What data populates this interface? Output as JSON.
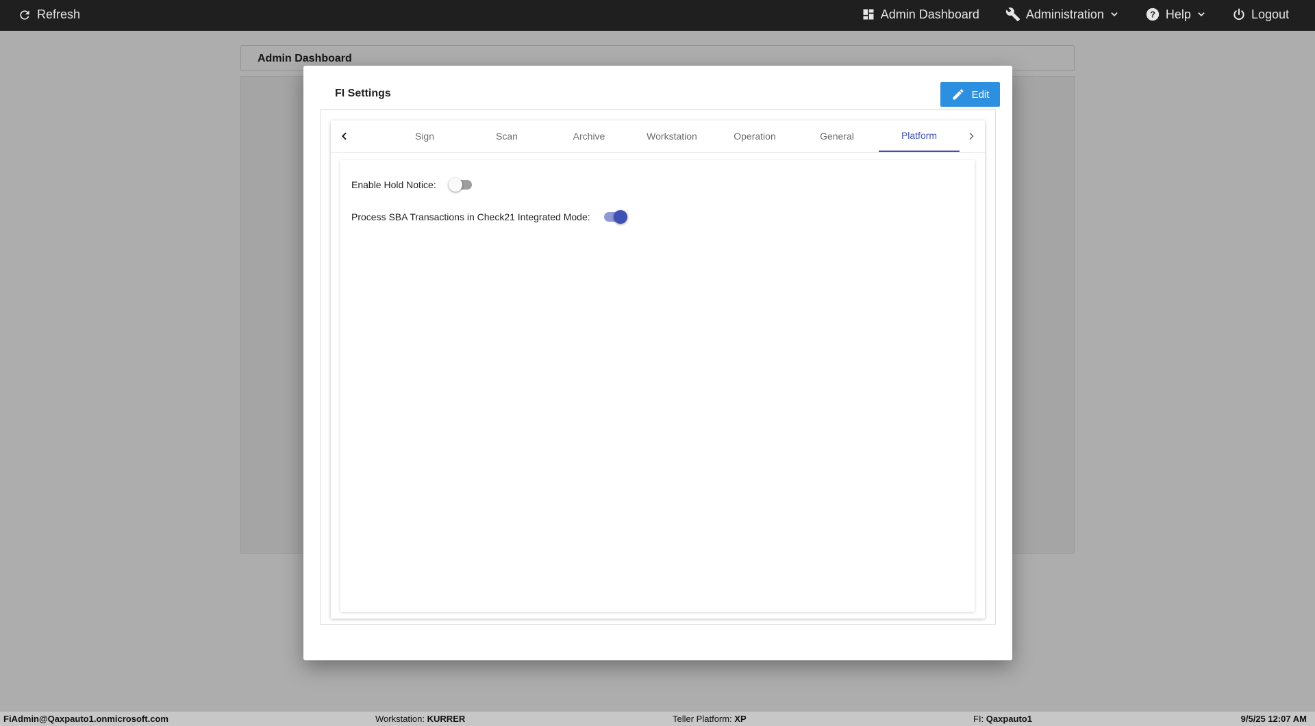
{
  "topbar": {
    "refresh_label": "Refresh",
    "nav": {
      "dashboard_label": "Admin Dashboard",
      "administration_label": "Administration",
      "help_label": "Help",
      "logout_label": "Logout"
    }
  },
  "page": {
    "panel_title": "Admin Dashboard"
  },
  "modal": {
    "title": "FI Settings",
    "edit_label": "Edit",
    "tabs": [
      {
        "label": "Sign"
      },
      {
        "label": "Scan"
      },
      {
        "label": "Archive"
      },
      {
        "label": "Workstation"
      },
      {
        "label": "Operation"
      },
      {
        "label": "General"
      },
      {
        "label": "Platform"
      }
    ],
    "active_tab": "Platform",
    "settings": [
      {
        "label": "Enable Hold Notice:",
        "enabled": false
      },
      {
        "label": "Process SBA Transactions in Check21 Integrated Mode:",
        "enabled": true
      }
    ]
  },
  "statusbar": {
    "user": "FiAdmin@Qaxpauto1.onmicrosoft.com",
    "workstation_label": "Workstation:",
    "workstation_value": "KURRER",
    "platform_label": "Teller Platform:",
    "platform_value": "XP",
    "fi_label": "FI:",
    "fi_value": "Qaxpauto1",
    "datetime": "9/5/25 12:07 AM"
  },
  "colors": {
    "topbar": "#1f1f1f",
    "edit_button": "#2d8fe0",
    "active_tab": "#3f51b5",
    "statusbar": "#c7c7c7"
  }
}
